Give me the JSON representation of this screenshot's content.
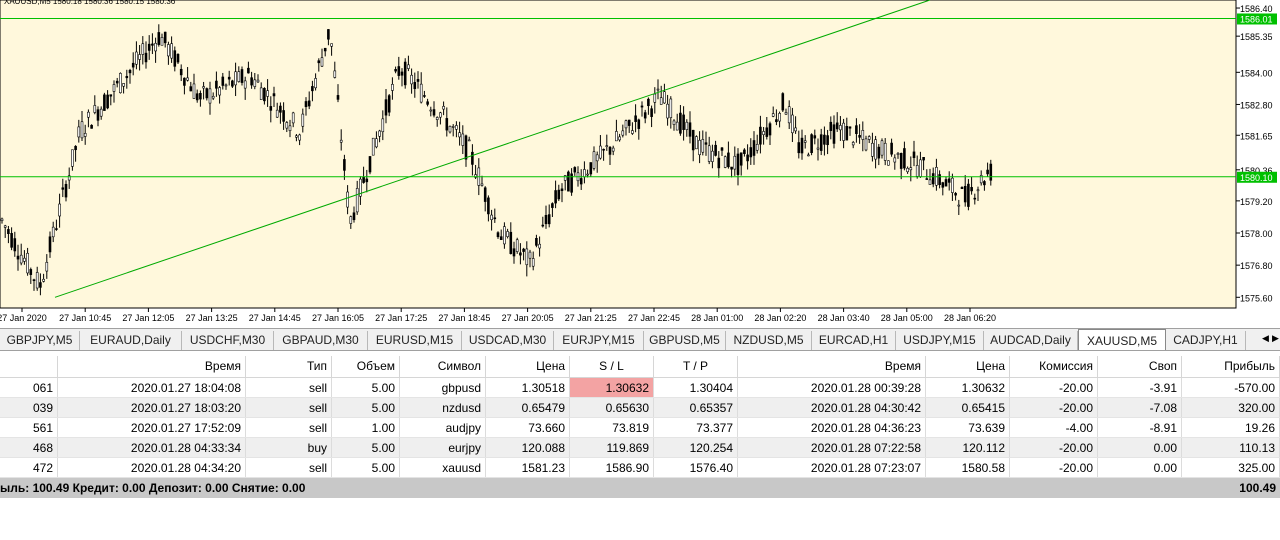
{
  "chart": {
    "info_text": "XAUUSD,M5  1580.18 1580.36 1580.15 1580.36",
    "price_levels": [
      "1586.40",
      "1585.35",
      "1584.00",
      "1582.80",
      "1581.65",
      "1580.36",
      "1579.20",
      "1578.00",
      "1576.80",
      "1575.60"
    ],
    "hline_labels": [
      "1586.01",
      "1580.10"
    ],
    "time_labels": [
      "27 Jan 2020",
      "27 Jan 10:45",
      "27 Jan 12:05",
      "27 Jan 13:25",
      "27 Jan 14:45",
      "27 Jan 16:05",
      "27 Jan 17:25",
      "27 Jan 18:45",
      "27 Jan 20:05",
      "27 Jan 21:25",
      "27 Jan 22:45",
      "28 Jan 01:00",
      "28 Jan 02:20",
      "28 Jan 03:40",
      "28 Jan 05:00",
      "28 Jan 06:20"
    ],
    "colors": {
      "background": "#fff8dc",
      "candle": "#000000",
      "level_line": "#00c000",
      "trend_line": "#00aa00",
      "current_price_bg": "#00c000"
    }
  },
  "tabs": [
    {
      "label": "GBPJPY,M5"
    },
    {
      "label": "EURAUD,Daily"
    },
    {
      "label": "USDCHF,M30"
    },
    {
      "label": "GBPAUD,M30"
    },
    {
      "label": "EURUSD,M15"
    },
    {
      "label": "USDCAD,M30"
    },
    {
      "label": "EURJPY,M15"
    },
    {
      "label": "GBPUSD,M5"
    },
    {
      "label": "NZDUSD,M5"
    },
    {
      "label": "EURCAD,H1"
    },
    {
      "label": "USDJPY,M15"
    },
    {
      "label": "AUDCAD,Daily"
    },
    {
      "label": "XAUUSD,M5",
      "active": true
    },
    {
      "label": "CADJPY,H1"
    }
  ],
  "table": {
    "headers": [
      "",
      "Время",
      "Тип",
      "Объем",
      "Символ",
      "Цена",
      "S / L",
      "T / P",
      "Время",
      "Цена",
      "Комиссия",
      "Своп",
      "Прибыль"
    ],
    "rows": [
      [
        "061",
        "2020.01.27 18:04:08",
        "sell",
        "5.00",
        "gbpusd",
        "1.30518",
        "1.30632",
        "1.30404",
        "2020.01.28 00:39:28",
        "1.30632",
        "-20.00",
        "-3.91",
        "-570.00"
      ],
      [
        "039",
        "2020.01.27 18:03:20",
        "sell",
        "5.00",
        "nzdusd",
        "0.65479",
        "0.65630",
        "0.65357",
        "2020.01.28 04:30:42",
        "0.65415",
        "-20.00",
        "-7.08",
        "320.00"
      ],
      [
        "561",
        "2020.01.27 17:52:09",
        "sell",
        "1.00",
        "audjpy",
        "73.660",
        "73.819",
        "73.377",
        "2020.01.28 04:36:23",
        "73.639",
        "-4.00",
        "-8.91",
        "19.26"
      ],
      [
        "468",
        "2020.01.28 04:33:34",
        "buy",
        "5.00",
        "eurjpy",
        "120.088",
        "119.869",
        "120.254",
        "2020.01.28 07:22:58",
        "120.112",
        "-20.00",
        "0.00",
        "110.13"
      ],
      [
        "472",
        "2020.01.28 04:34:20",
        "sell",
        "5.00",
        "xauusd",
        "1581.23",
        "1586.90",
        "1576.40",
        "2020.01.28 07:23:07",
        "1580.58",
        "-20.00",
        "0.00",
        "325.00"
      ]
    ],
    "summary_text": "ыль: 100.49  Кредит: 0.00  Депозит: 0.00  Снятие: 0.00",
    "summary_total": "100.49"
  }
}
